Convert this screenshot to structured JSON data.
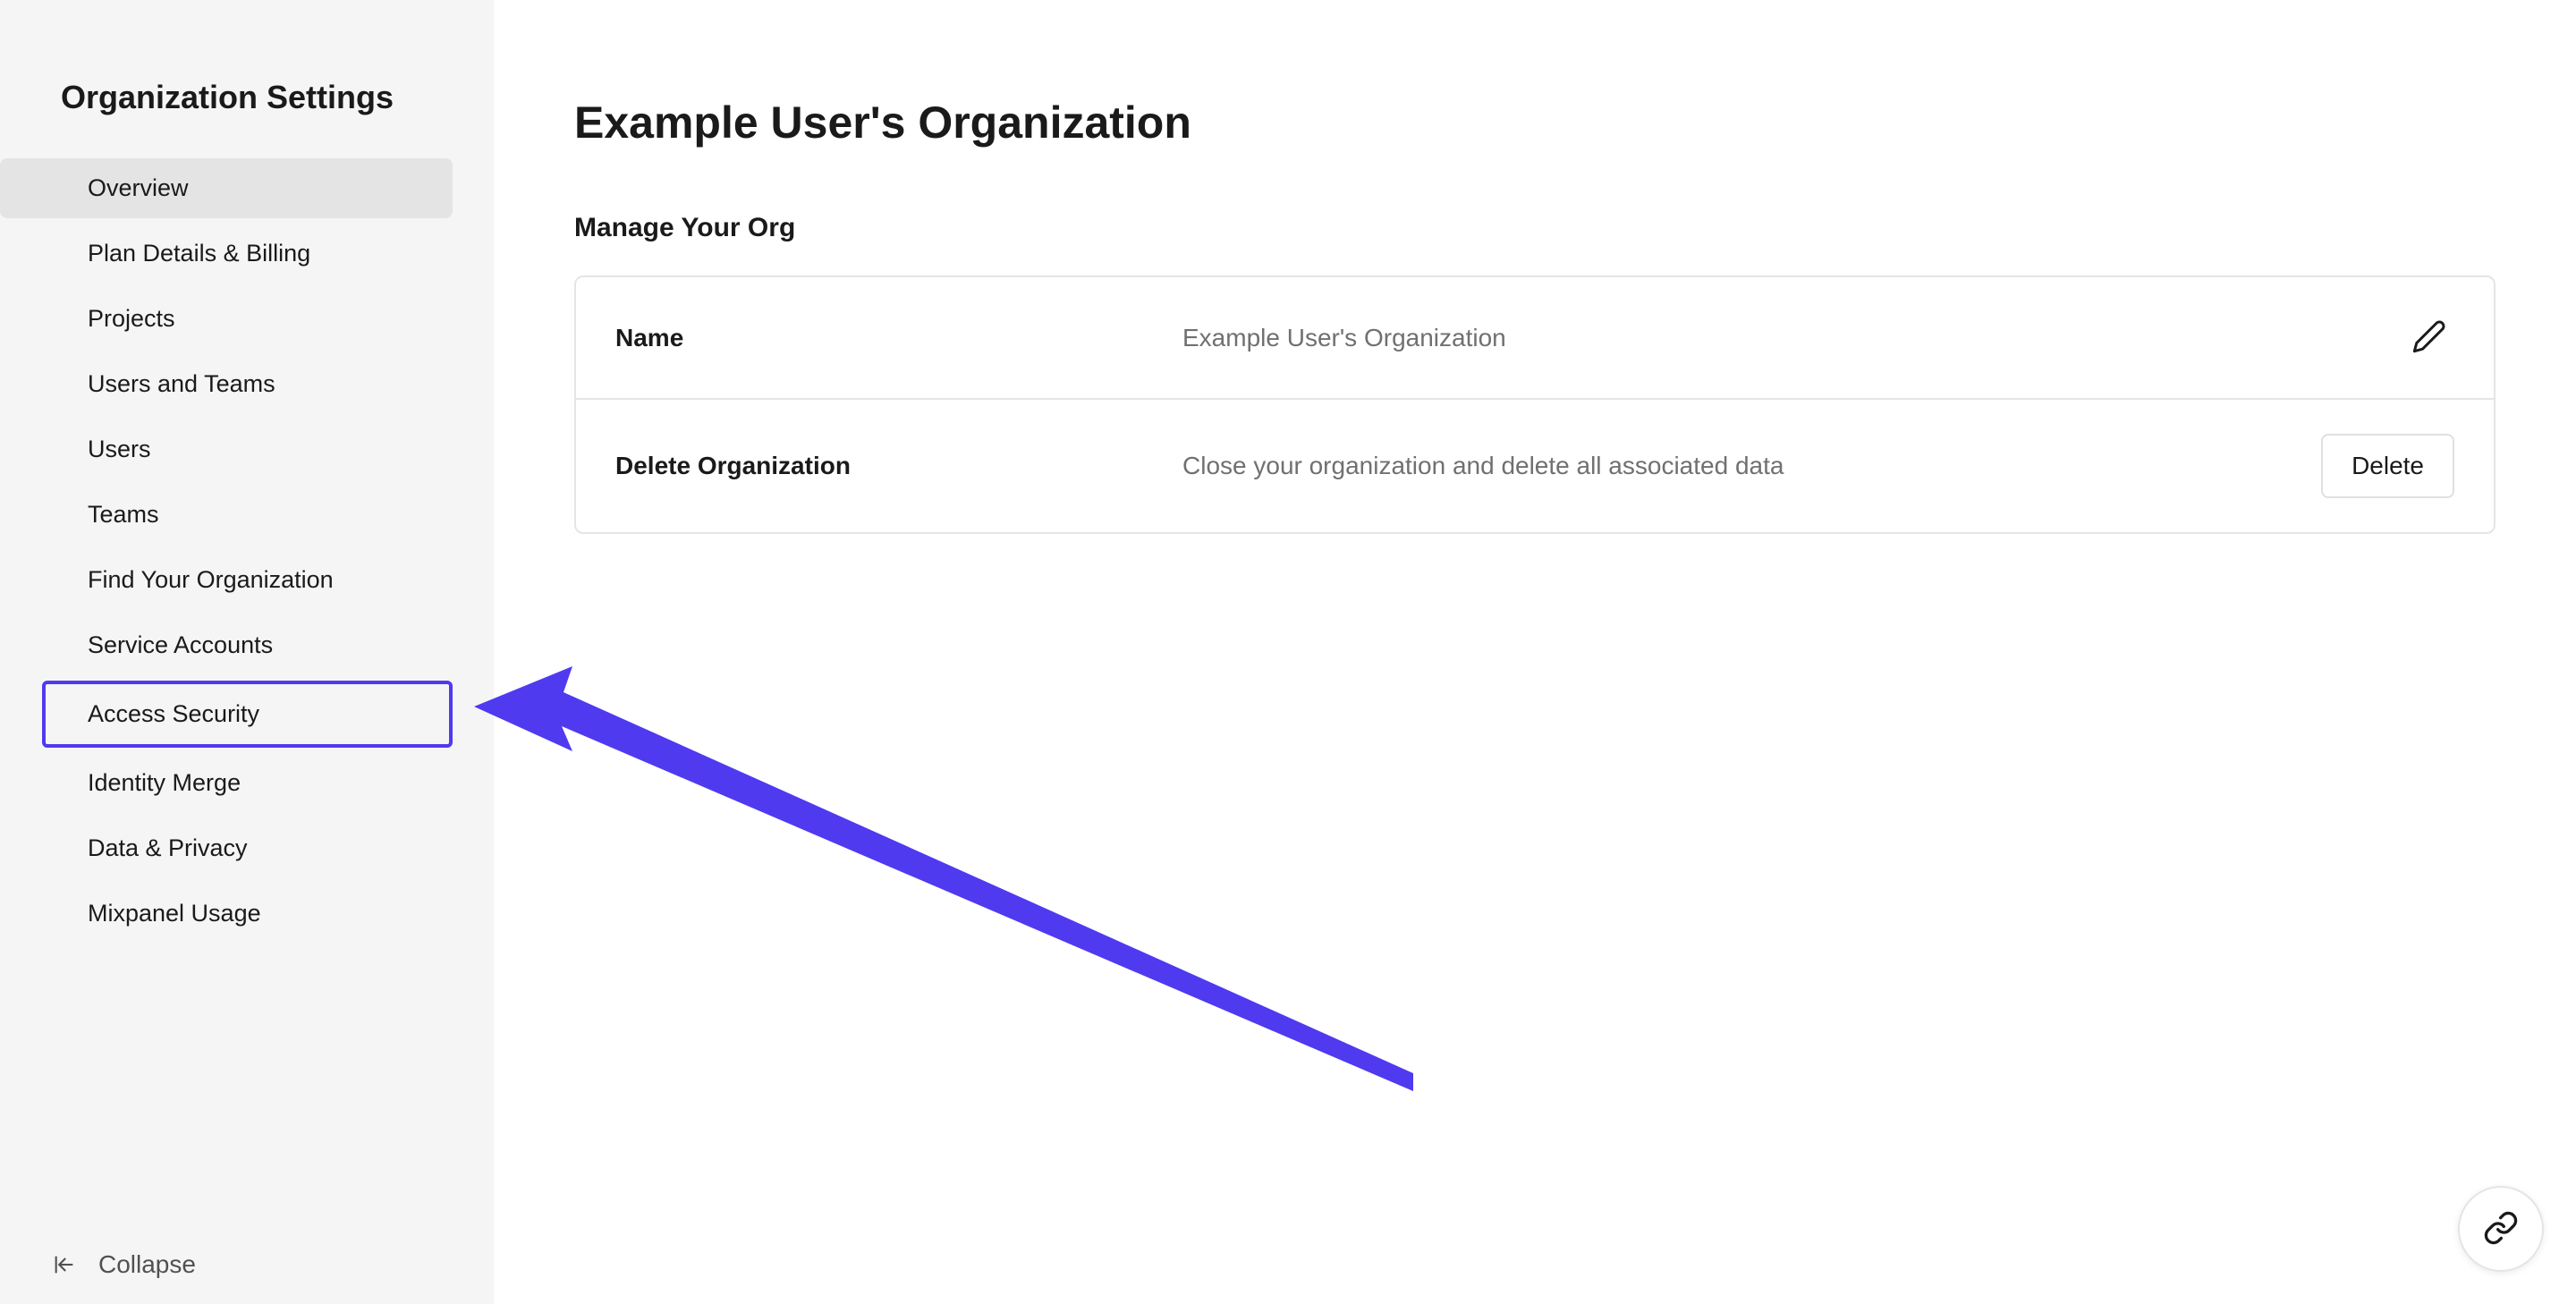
{
  "sidebar": {
    "title": "Organization Settings",
    "items": [
      {
        "label": "Overview",
        "active": true,
        "highlighted": false
      },
      {
        "label": "Plan Details & Billing",
        "active": false,
        "highlighted": false
      },
      {
        "label": "Projects",
        "active": false,
        "highlighted": false
      },
      {
        "label": "Users and Teams",
        "active": false,
        "highlighted": false
      },
      {
        "label": "Users",
        "active": false,
        "highlighted": false
      },
      {
        "label": "Teams",
        "active": false,
        "highlighted": false
      },
      {
        "label": "Find Your Organization",
        "active": false,
        "highlighted": false
      },
      {
        "label": "Service Accounts",
        "active": false,
        "highlighted": false
      },
      {
        "label": "Access Security",
        "active": false,
        "highlighted": true
      },
      {
        "label": "Identity Merge",
        "active": false,
        "highlighted": false
      },
      {
        "label": "Data & Privacy",
        "active": false,
        "highlighted": false
      },
      {
        "label": "Mixpanel Usage",
        "active": false,
        "highlighted": false
      }
    ],
    "collapse_label": "Collapse"
  },
  "main": {
    "page_title": "Example User's Organization",
    "section_title": "Manage Your Org",
    "rows": {
      "name": {
        "label": "Name",
        "value": "Example User's Organization"
      },
      "delete": {
        "label": "Delete Organization",
        "value": "Close your organization and delete all associated data",
        "button": "Delete"
      }
    }
  },
  "annotation": {
    "arrow_color": "#4f3af0"
  }
}
